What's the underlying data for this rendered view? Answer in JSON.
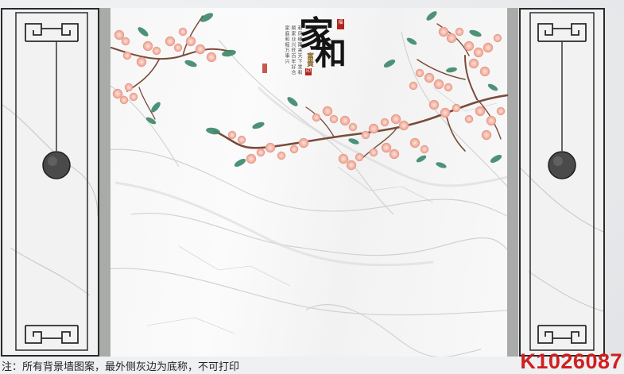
{
  "artwork": {
    "title_chars": [
      "家",
      "和"
    ],
    "subtitle": "富貴",
    "seal_top": "福",
    "seal_small": "印",
    "poem": "和风细雨来天下发和顺家业兴旺百年好合家庭和睦万事兴",
    "colors": {
      "marble": "#f7f7f7",
      "frame": "#2a2a2a",
      "strip": "#a9aba8",
      "blossom": "#f4b7a8",
      "leaf": "#3f8a6e",
      "branch": "#7a4b3a",
      "code": "#d11f1f",
      "seal": "#b2231e"
    }
  },
  "footer": {
    "note": "注：所有背景墙图案，最外侧灰边为底称，不可打印",
    "code": "K1026087"
  }
}
